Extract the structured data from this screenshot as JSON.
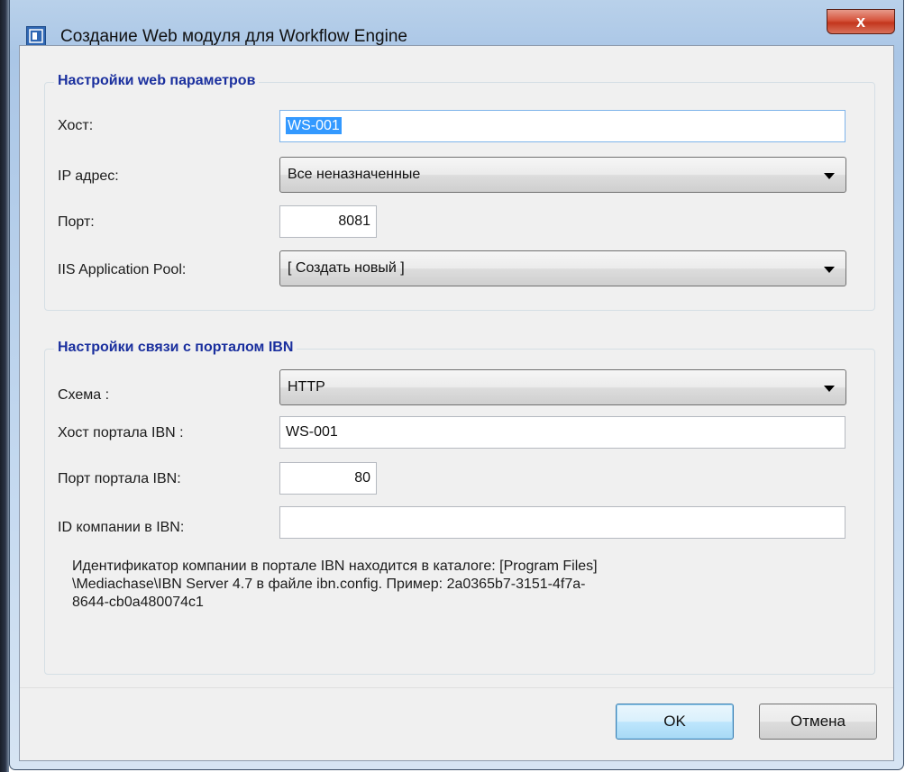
{
  "window": {
    "title": "Создание Web модуля для Workflow Engine",
    "close_label": "x"
  },
  "web_settings": {
    "legend": "Настройки web параметров",
    "host_label": "Хост:",
    "host_value": "WS-001",
    "ip_label": "IP адрес:",
    "ip_value": "Все неназначенные",
    "port_label": "Порт:",
    "port_value": "8081",
    "pool_label": "IIS Application Pool:",
    "pool_value": "[ Создать новый ]"
  },
  "ibn_settings": {
    "legend": "Настройки связи с порталом IBN",
    "scheme_label": "Схема :",
    "scheme_value": "HTTP",
    "portal_host_label": "Хост портала IBN :",
    "portal_host_value": "WS-001",
    "portal_port_label": "Порт портала IBN:",
    "portal_port_value": "80",
    "company_id_label": "ID компании в IBN:",
    "company_id_value": "",
    "info_line1": "Идентификатор компании в портале IBN находится в каталоге: [Program Files]",
    "info_line2": "\\Mediachase\\IBN Server 4.7  в файле ibn.config. Пример:  2a0365b7-3151-4f7a-",
    "info_line3": "8644-cb0a480074c1"
  },
  "buttons": {
    "ok": "OK",
    "cancel": "Отмена"
  },
  "colors": {
    "legend": "#1a2f9e",
    "close_button": "#c3361d",
    "selection": "#3399ff"
  }
}
